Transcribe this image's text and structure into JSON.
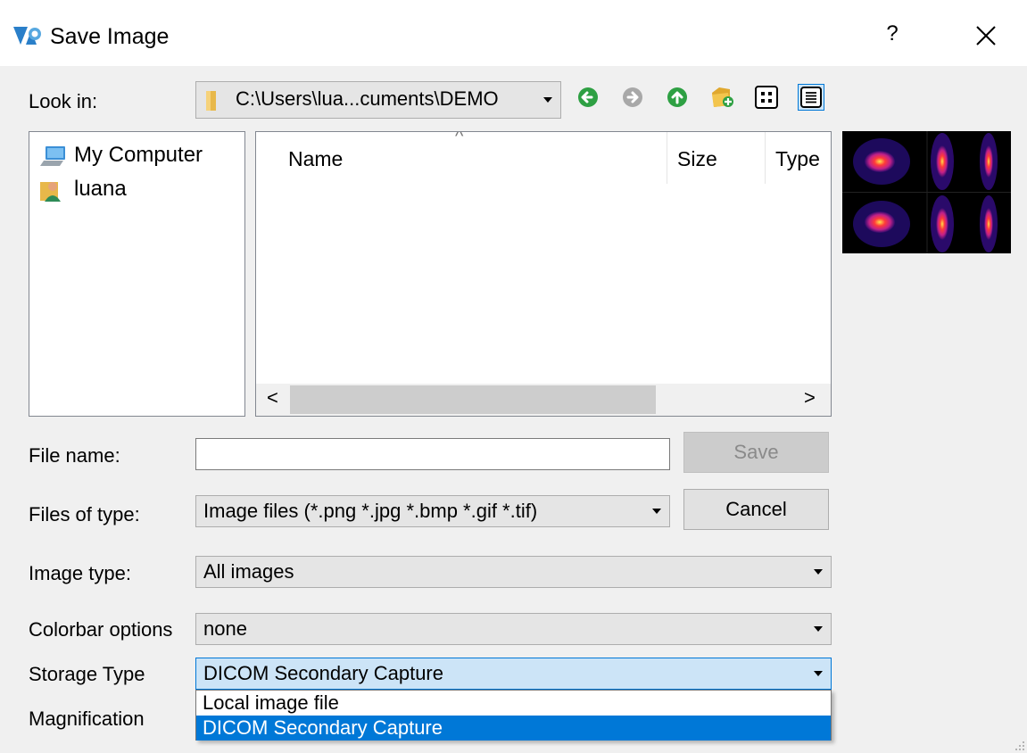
{
  "window": {
    "title": "Save Image",
    "help_label": "?"
  },
  "look_in": {
    "label": "Look in:",
    "path": "C:\\Users\\lua...cuments\\DEMO"
  },
  "toolbar": [
    "back-icon",
    "forward-icon",
    "up-folder-icon",
    "new-folder-icon",
    "list-view-icon",
    "detail-view-icon"
  ],
  "sidebar": {
    "items": [
      {
        "label": "My Computer",
        "icon": "computer-icon"
      },
      {
        "label": "luana",
        "icon": "user-icon"
      }
    ]
  },
  "file_list": {
    "columns": [
      "Name",
      "Size",
      "Type"
    ],
    "sort_indicator": "^"
  },
  "scrollbar": {
    "left": "<",
    "right": ">"
  },
  "file_name": {
    "label": "File name:",
    "value": ""
  },
  "files_of_type": {
    "label": "Files of type:",
    "value": "Image files (*.png *.jpg *.bmp *.gif *.tif)"
  },
  "image_type": {
    "label": "Image type:",
    "value": "All images"
  },
  "colorbar": {
    "label": "Colorbar options",
    "value": "none"
  },
  "storage": {
    "label": "Storage Type",
    "value": "DICOM Secondary Capture",
    "options": [
      "Local image file",
      "DICOM Secondary Capture"
    ]
  },
  "magnification": {
    "label": "Magnification"
  },
  "buttons": {
    "save": "Save",
    "cancel": "Cancel"
  },
  "colors": {
    "selection": "#0078d7",
    "combo_focus": "#cce4f7",
    "accent_border": "#0078d7",
    "toolbar_green": "#2ea043"
  }
}
